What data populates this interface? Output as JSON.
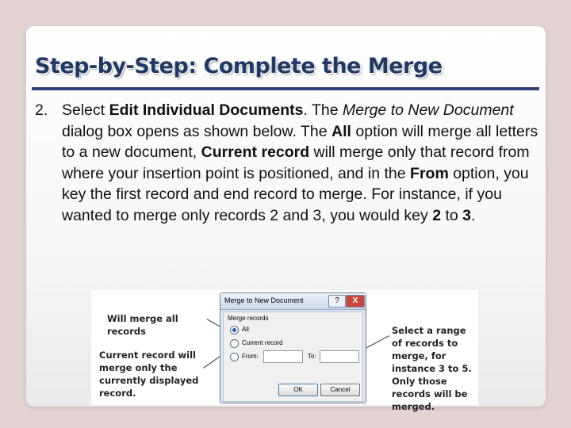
{
  "title": "Step-by-Step: Complete the Merge",
  "item": {
    "number": "2.",
    "segments": [
      {
        "text": "Select ",
        "style": "normal"
      },
      {
        "text": "Edit Individual Documents",
        "style": "bold"
      },
      {
        "text": ". The ",
        "style": "normal"
      },
      {
        "text": "Merge to New Document",
        "style": "italic"
      },
      {
        "text": " dialog box opens as shown below. The ",
        "style": "normal"
      },
      {
        "text": "All",
        "style": "bold"
      },
      {
        "text": " option will merge all letters to a new document, ",
        "style": "normal"
      },
      {
        "text": "Current record",
        "style": "bold"
      },
      {
        "text": " will merge only that record from where your insertion point is positioned, and in the ",
        "style": "normal"
      },
      {
        "text": "From",
        "style": "bold"
      },
      {
        "text": " option, you key the first record and end record to merge. For instance, if you wanted to merge only records 2 and 3, you would key ",
        "style": "normal"
      },
      {
        "text": "2",
        "style": "bold"
      },
      {
        "text": " to ",
        "style": "normal"
      },
      {
        "text": "3",
        "style": "bold"
      },
      {
        "text": ".",
        "style": "normal"
      }
    ]
  },
  "figure": {
    "callout_all": "Will merge all records",
    "callout_current": "Current record will merge only the currently displayed record.",
    "callout_range": "Select a range of records to merge, for instance 3 to 5. Only those records will be merged.",
    "dialog": {
      "title": "Merge to New Document",
      "help": "?",
      "close": "X",
      "group_label": "Merge records",
      "options": [
        {
          "label": "All",
          "selected": true
        },
        {
          "label": "Current record",
          "selected": false
        },
        {
          "label": "From:",
          "selected": false
        }
      ],
      "from_value": "",
      "to_label": "To:",
      "to_value": "",
      "ok": "OK",
      "cancel": "Cancel"
    }
  }
}
